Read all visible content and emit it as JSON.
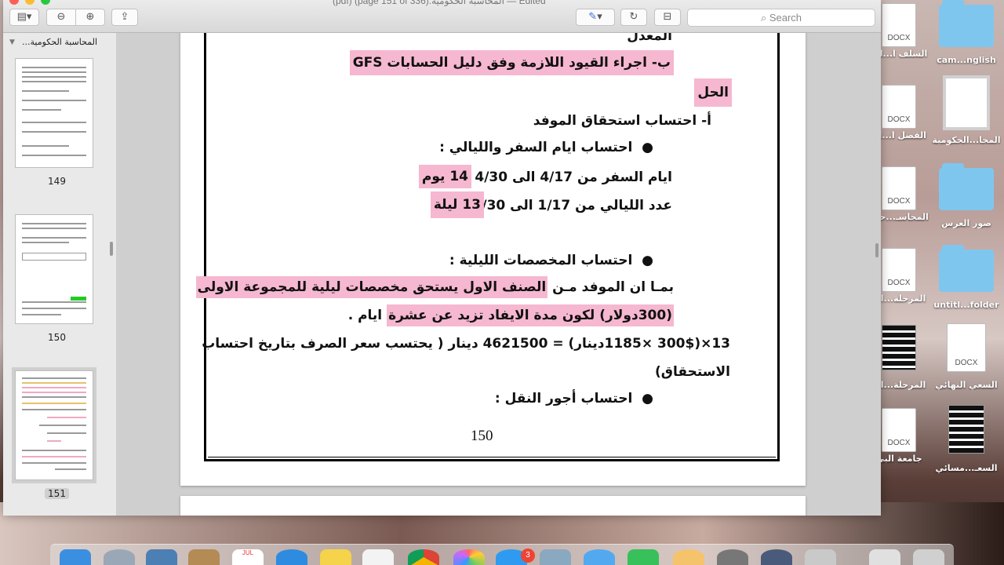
{
  "window": {
    "title": "(pdf) (page 151 of 336).المحاسبة الحكومية",
    "edited": "Edited"
  },
  "toolbar": {
    "search_placeholder": "Search",
    "icons": [
      "sidebar-toggle-icon",
      "zoom-out-icon",
      "zoom-in-icon",
      "share-icon",
      "markup-pen-icon",
      "rotate-icon",
      "toolbox-icon"
    ]
  },
  "sidebar": {
    "heading": "المحاسبة الحكومية...",
    "pages": [
      {
        "number": "149",
        "selected": false
      },
      {
        "number": "150",
        "selected": false
      },
      {
        "number": "151",
        "selected": true
      }
    ]
  },
  "document": {
    "line_top": "المعدل",
    "heading_b": "ب- اجراء القيود اللازمة وفق دليل الحسابات GFS",
    "solution": "الحل",
    "heading_a": "أ- احتساب استحقاق الموفد",
    "bullet1": "احتساب ايام السفر والليالي :",
    "days_text": "ايام السفر من 4/17 الى 4/30",
    "days_value": "14 يوم",
    "nights_text": "عدد الليالي من 1/17 الى 4/30",
    "nights_value": "13 ليلة",
    "bullet2": "احتساب المخصصات الليلية :",
    "para1_plain": "بمـا ان الموفد مـن ",
    "para1_hl": "الصنف الاول يستحق مخصصات ليلية للمجموعة الاولى",
    "para2_hl": "(300دولار) لكون مدة الايفاد تزيد عن عشرة",
    "para2_plain": " ايام .",
    "calc_line": "13×(300$ ×1185دينار) = 4621500 دينار ( يحتسب سعر الصرف بتاريخ احتساب",
    "calc_line2": "الاستحقاق)",
    "bullet3": "احتساب أجور النقل :",
    "page_number": "150"
  },
  "desktop_icons": [
    {
      "label": "السلف ا...لت",
      "type": "docx",
      "badge": "DOCX"
    },
    {
      "label": "cam...nglish",
      "type": "folder"
    },
    {
      "label": "الفصل ا...ال",
      "type": "docx",
      "badge": "DOCX"
    },
    {
      "label": "المحا...الحكومية",
      "type": "pdf"
    },
    {
      "label": "المحاسـ...حكو",
      "type": "docx",
      "badge": "DOCX"
    },
    {
      "label": "صور العرس",
      "type": "folder"
    },
    {
      "label": "المرحلة...ات",
      "type": "docx",
      "badge": "DOCX"
    },
    {
      "label": "untitl...folder",
      "type": "folder"
    },
    {
      "label": "المرحلة...ات",
      "type": "sheet"
    },
    {
      "label": "السعي النهائي",
      "type": "docx",
      "badge": "DOCX"
    },
    {
      "label": "جامعة البي",
      "type": "docx",
      "badge": "DOCX"
    },
    {
      "label": "السعـ...مسائي",
      "type": "pdf"
    }
  ],
  "dock": {
    "badge_count": "3",
    "calendar_month": "JUL"
  }
}
